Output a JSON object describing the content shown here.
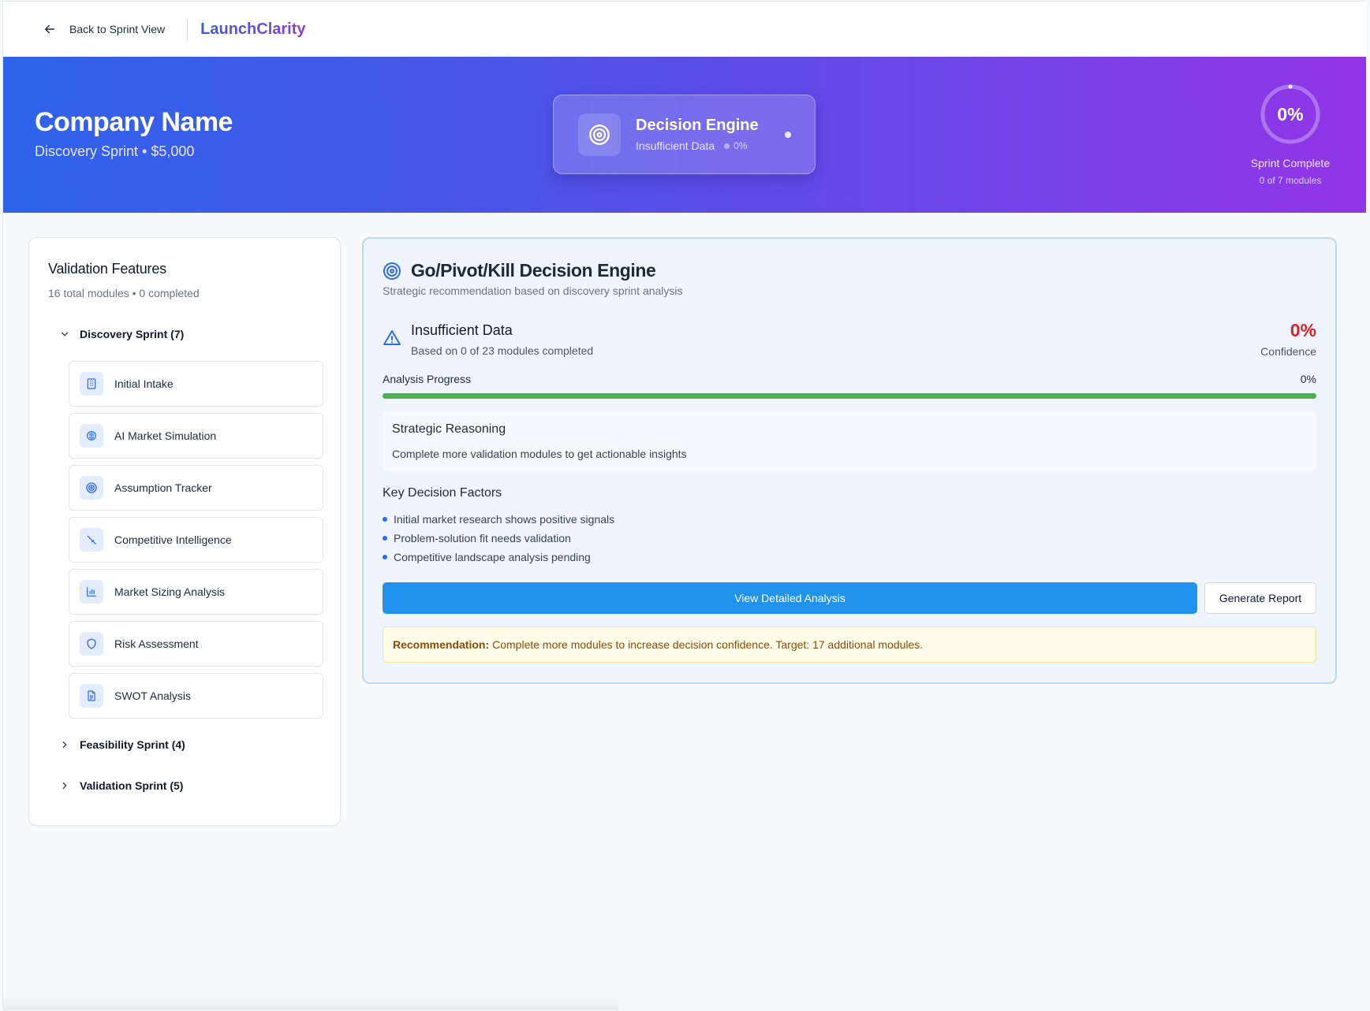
{
  "nav": {
    "back_label": "Back to Sprint View",
    "brand": "LaunchClarity"
  },
  "hero": {
    "company": "Company Name",
    "subtitle": "Discovery Sprint • $5,000",
    "engine_title": "Decision Engine",
    "engine_status": "Insufficient Data",
    "engine_pct": "0%",
    "progress_value": "0%",
    "progress_fraction": 0,
    "progress_label": "Sprint Complete",
    "progress_sub": "0 of 7 modules"
  },
  "sidebar": {
    "title": "Validation Features",
    "subtitle": "16 total modules • 0 completed",
    "groups": [
      {
        "label": "Discovery Sprint (7)",
        "expanded": true
      },
      {
        "label": "Feasibility Sprint (4)",
        "expanded": false
      },
      {
        "label": "Validation Sprint (5)",
        "expanded": false
      }
    ],
    "modules": [
      {
        "label": "Initial Intake",
        "icon": "building-icon"
      },
      {
        "label": "AI Market Simulation",
        "icon": "brain-icon"
      },
      {
        "label": "Assumption Tracker",
        "icon": "target-icon"
      },
      {
        "label": "Competitive Intelligence",
        "icon": "sword-icon"
      },
      {
        "label": "Market Sizing Analysis",
        "icon": "bar-chart-icon"
      },
      {
        "label": "Risk Assessment",
        "icon": "shield-icon"
      },
      {
        "label": "SWOT Analysis",
        "icon": "document-icon"
      }
    ]
  },
  "main": {
    "title": "Go/Pivot/Kill Decision Engine",
    "subtitle": "Strategic recommendation based on discovery sprint analysis",
    "status_title": "Insufficient Data",
    "status_sub": "Based on 0 of 23 modules completed",
    "confidence_value": "0%",
    "confidence_label": "Confidence",
    "progress_label": "Analysis Progress",
    "progress_pct": "0%",
    "progress_fraction": 0,
    "reasoning_title": "Strategic Reasoning",
    "reasoning_text": "Complete more validation modules to get actionable insights",
    "factors_title": "Key Decision Factors",
    "factors": [
      "Initial market research shows positive signals",
      "Problem-solution fit needs validation",
      "Competitive landscape analysis pending"
    ],
    "primary_button": "View Detailed Analysis",
    "secondary_button": "Generate Report",
    "recommendation_label": "Recommendation:",
    "recommendation_text": "Complete more modules to increase decision confidence. Target: 17 additional modules."
  },
  "colors": {
    "accent": "#2193ed",
    "danger": "#dc2626",
    "progress": "#4caf50",
    "hero_start": "#2f63ea",
    "hero_end": "#9235e6"
  }
}
